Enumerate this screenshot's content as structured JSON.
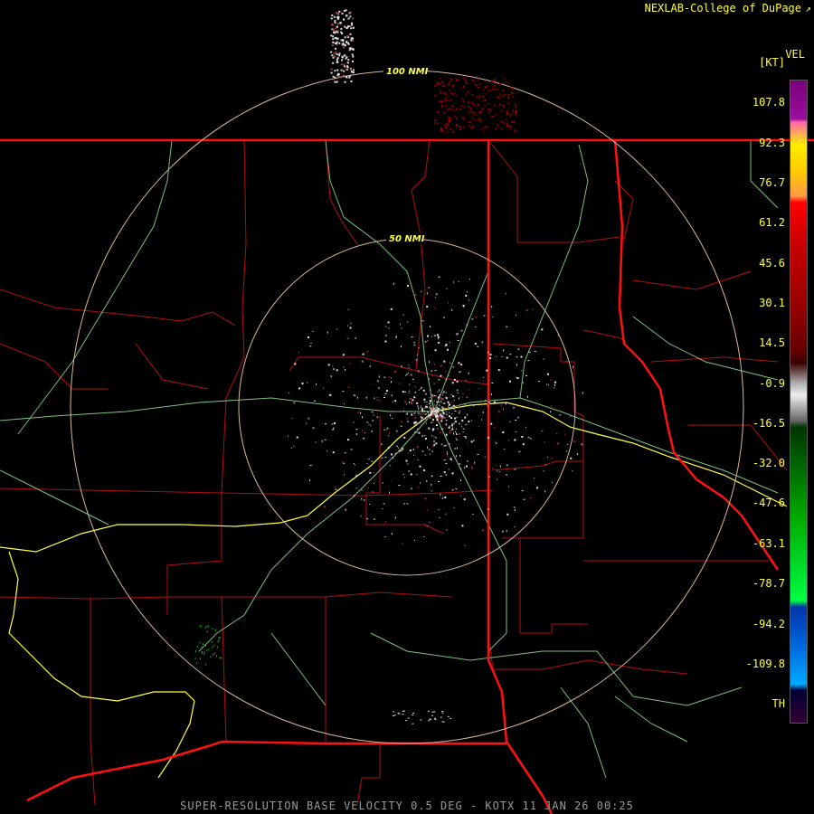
{
  "header": {
    "source": "NEXLAB-College of DuPage",
    "link_icon": "external-link-icon",
    "product": "VEL",
    "unit": "[KT]"
  },
  "range_rings": [
    {
      "label": "50 NMI",
      "radius_nmi": 50
    },
    {
      "label": "100 NMI",
      "radius_nmi": 100
    }
  ],
  "legend": {
    "labels": [
      "107.8",
      "92.3",
      "76.7",
      "61.2",
      "45.6",
      "30.1",
      "14.5",
      "-0.9",
      "-16.5",
      "-32.0",
      "-47.6",
      "-63.1",
      "-78.7",
      "-94.2",
      "-109.8",
      "TH"
    ]
  },
  "footer": "SUPER-RESOLUTION BASE VELOCITY 0.5 DEG - KOTX 11 JAN 26 00:25",
  "colors": {
    "state_border": "#ff1111",
    "county_border": "#b01010",
    "interstate": "#ffff44",
    "highway": "#7fbf7f",
    "range_ring": "#d9b99b",
    "label_text": "#ffff44"
  }
}
